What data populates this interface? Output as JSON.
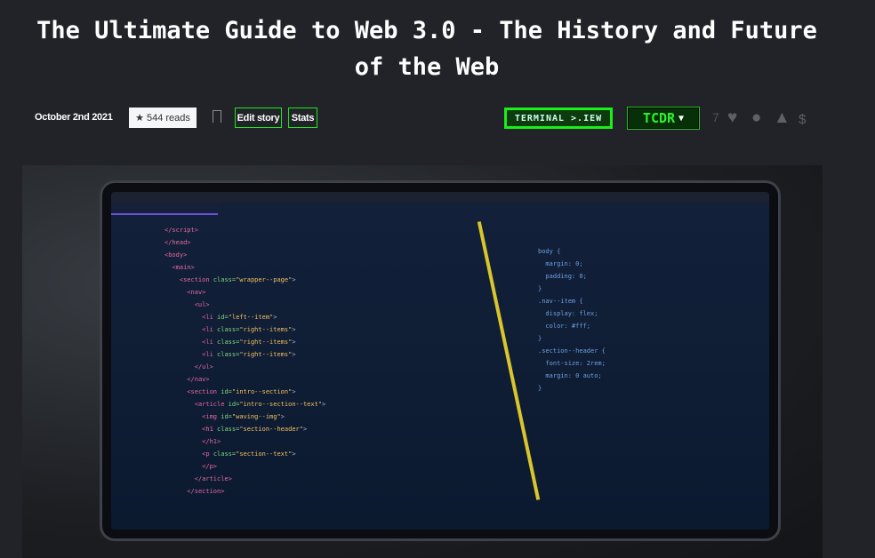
{
  "article": {
    "title": "The Ultimate Guide to Web 3.0 - The History and Future of the Web"
  },
  "meta": {
    "date": "October 2nd 2021",
    "reads": "544 reads",
    "edit_label": "Edit story",
    "stats_label": "Stats",
    "terminal_view_label": "TERMINAL >.IEW",
    "tcdr_label": "TCDR",
    "reactions_count": "7"
  },
  "icons": {
    "star": "star-icon",
    "bookmark": "bookmark-icon",
    "heart": "heart-icon",
    "lightbulb": "lightbulb-icon",
    "wizard_hat": "wizard-hat-icon",
    "money_bag": "money-bag-icon"
  },
  "colors": {
    "background": "#212328",
    "accent_green": "#1ee61e"
  }
}
